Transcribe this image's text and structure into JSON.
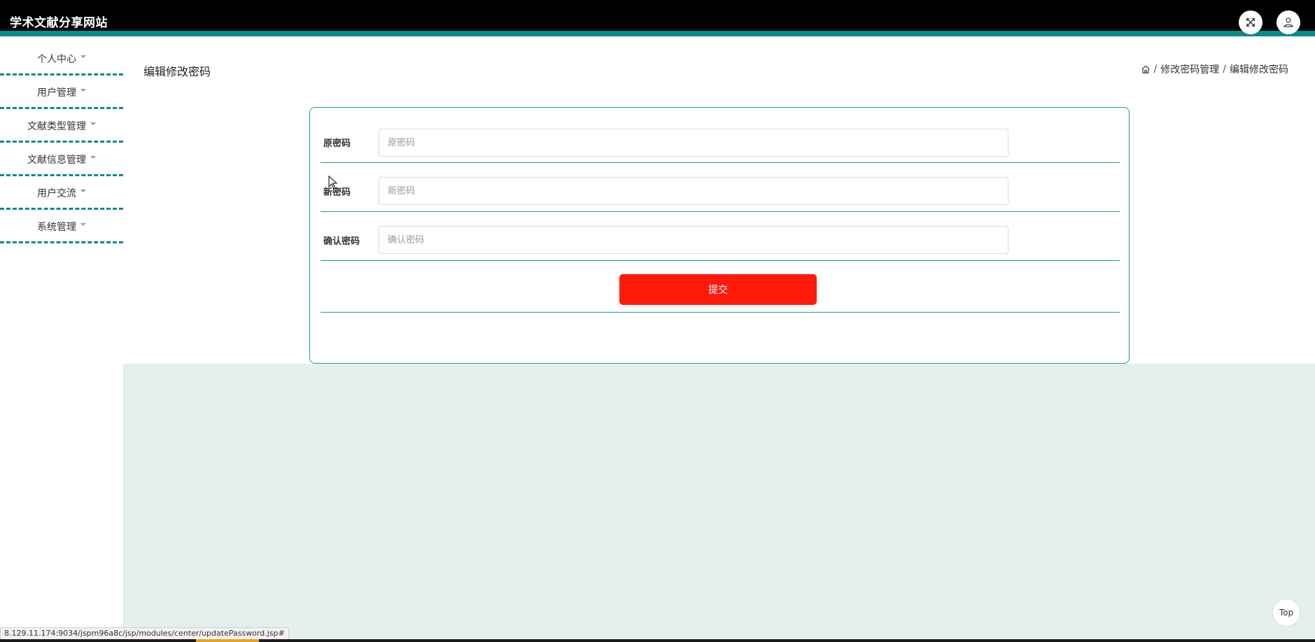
{
  "header": {
    "title": "学术文献分享网站",
    "fullscreen_icon": "expand-icon",
    "user_icon": "user-icon"
  },
  "sidebar": {
    "items": [
      {
        "label": "个人中心"
      },
      {
        "label": "用户管理"
      },
      {
        "label": "文献类型管理"
      },
      {
        "label": "文献信息管理"
      },
      {
        "label": "用户交流"
      },
      {
        "label": "系统管理"
      }
    ]
  },
  "page": {
    "heading": "编辑修改密码",
    "breadcrumb": {
      "home_icon": "home-icon",
      "separator": "/",
      "items": [
        "修改密码管理",
        "编辑修改密码"
      ]
    }
  },
  "form": {
    "fields": [
      {
        "label": "原密码",
        "placeholder": "原密码",
        "value": ""
      },
      {
        "label": "新密码",
        "placeholder": "新密码",
        "value": ""
      },
      {
        "label": "确认密码",
        "placeholder": "确认密码",
        "value": ""
      }
    ],
    "submit_label": "提交"
  },
  "footer": {
    "top_label": "Top",
    "status_url": "8.129.11.174:9034/jspm96a8c/jsp/modules/center/updatePassword.jsp#"
  },
  "colors": {
    "header_bg": "#000000",
    "accent": "#0a8a8a",
    "submit_bg": "#ff1a0a",
    "band_bg": "#e3f0eb"
  }
}
